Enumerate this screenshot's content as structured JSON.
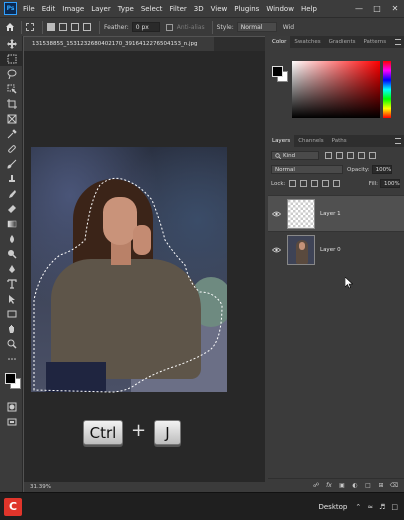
{
  "app": {
    "logo": "Ps"
  },
  "menu": [
    "File",
    "Edit",
    "Image",
    "Layer",
    "Type",
    "Select",
    "Filter",
    "3D",
    "View",
    "Plugins",
    "Window",
    "Help"
  ],
  "window_controls": {
    "minimize": "—",
    "maximize": "□",
    "close": "✕"
  },
  "options": {
    "feather_label": "Feather:",
    "feather_value": "0 px",
    "antialias_label": "Anti-alias",
    "style_label": "Style:",
    "style_value": "Normal",
    "width_label": "Wid"
  },
  "document": {
    "tab_title": "131538855_1531232680402170_3916412276504153_n.jpg",
    "zoom": "31.39%"
  },
  "overlay": {
    "key1": "Ctrl",
    "plus": "+",
    "key2": "J"
  },
  "color_panel": {
    "tabs": [
      "Color",
      "Swatches",
      "Gradients",
      "Patterns"
    ]
  },
  "layers_panel": {
    "tabs": [
      "Layers",
      "Channels",
      "Paths"
    ],
    "filter_kind": "Kind",
    "blend_mode": "Normal",
    "opacity_label": "Opacity:",
    "opacity_value": "100%",
    "lock_label": "Lock:",
    "fill_label": "Fill:",
    "fill_value": "100%",
    "layers": [
      {
        "name": "Layer 1",
        "selected": true
      },
      {
        "name": "Layer 0",
        "selected": false
      }
    ]
  },
  "taskbar": {
    "desktop_label": "Desktop",
    "app_icon": "C"
  },
  "colors": {
    "accent": "#31a8ff",
    "foreground": "#000000",
    "background": "#ffffff"
  }
}
